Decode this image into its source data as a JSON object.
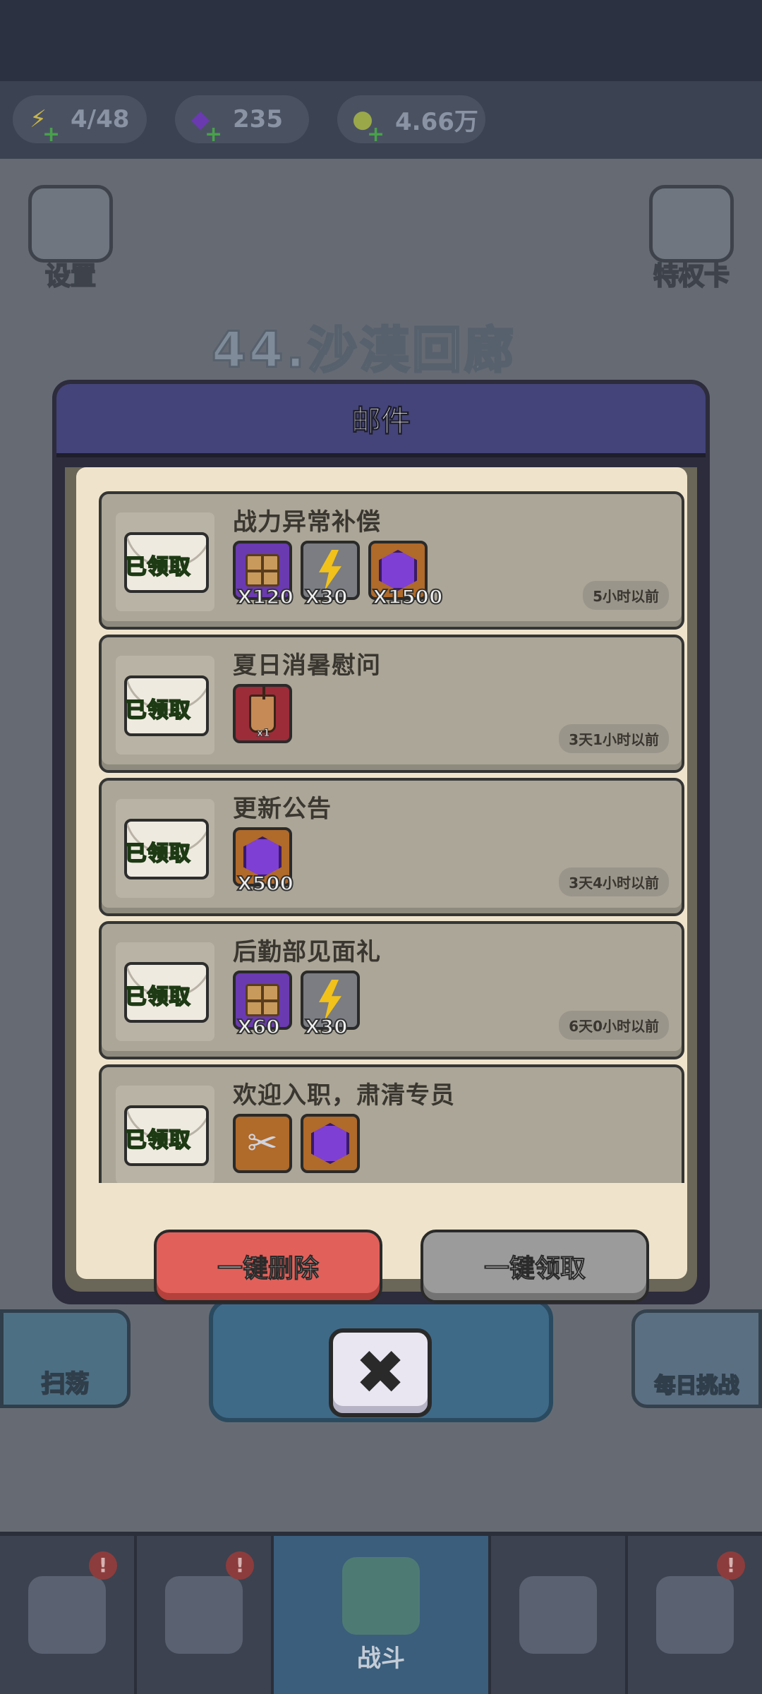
{
  "resources": {
    "energy": "4/48",
    "gems": "235",
    "coins": "4.66万"
  },
  "background": {
    "settings_label": "设置",
    "privilege_label": "特权卡",
    "level_title": "44.沙漠回廊",
    "sweep_label": "扫荡",
    "daily_challenge_label": "每日挑战",
    "fight_label": "战斗",
    "notification_mark": "!"
  },
  "modal": {
    "title": "邮件",
    "claimed_label": "已领取",
    "mails": [
      {
        "title": "战力异常补偿",
        "time": "5小时以前",
        "items": [
          {
            "type": "chest",
            "qty": "X120"
          },
          {
            "type": "energy",
            "qty": "X30"
          },
          {
            "type": "gem",
            "qty": "X1500"
          }
        ]
      },
      {
        "title": "夏日消暑慰问",
        "time": "3天1小时以前",
        "items": [
          {
            "type": "milk-tea",
            "qty": "x1"
          }
        ]
      },
      {
        "title": "更新公告",
        "time": "3天4小时以前",
        "items": [
          {
            "type": "gem",
            "qty": "X500"
          }
        ]
      },
      {
        "title": "后勤部见面礼",
        "time": "6天0小时以前",
        "items": [
          {
            "type": "chest",
            "qty": "X60"
          },
          {
            "type": "energy",
            "qty": "X30"
          }
        ]
      },
      {
        "title": "欢迎入职，肃清专员",
        "time": "",
        "items": [
          {
            "type": "scissors",
            "qty": ""
          },
          {
            "type": "gem",
            "qty": ""
          }
        ]
      }
    ],
    "delete_all_label": "一键删除",
    "claim_all_label": "一键领取",
    "close_symbol": "✖"
  }
}
